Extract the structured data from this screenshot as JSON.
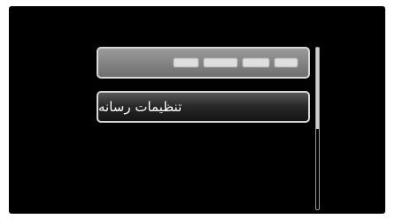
{
  "menu": {
    "items": [
      {
        "label": "",
        "state": "disabled-blurred"
      },
      {
        "label": "تنظیمات رسانه",
        "state": "selected"
      }
    ]
  },
  "scrollbar": {
    "position": 0.0,
    "visible_fraction": 0.5
  },
  "colors": {
    "screen_background": "#000000",
    "item_border": "#d8d8d8",
    "text": "#ffffff"
  }
}
